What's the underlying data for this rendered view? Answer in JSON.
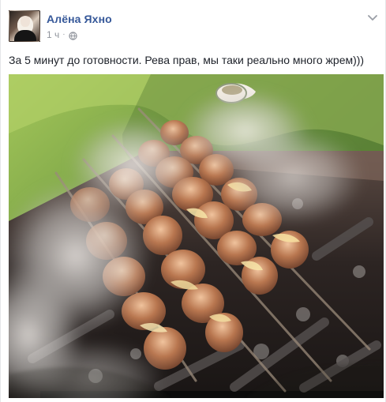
{
  "post": {
    "author": "Алёна Яхно",
    "time": "1 ч",
    "separator": "·",
    "privacy_icon": "globe-icon",
    "options_icon": "chevron-down-icon",
    "text": "За 5 минут до готовности. Рева прав, мы таки реально много жрем)))",
    "image_subject": "shashlik-on-grill-photo"
  },
  "colors": {
    "link": "#365899",
    "meta": "#90949c",
    "text": "#1d2129"
  }
}
